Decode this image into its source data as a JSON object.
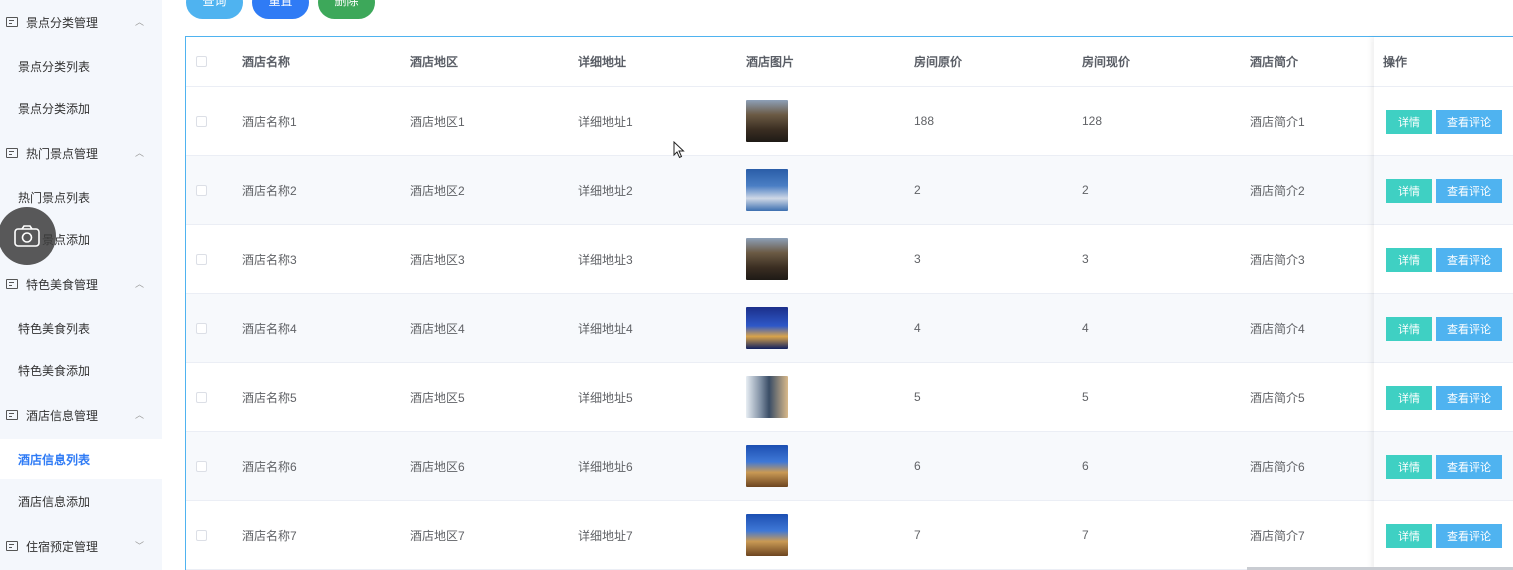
{
  "sidebar": {
    "groups": [
      {
        "label": "景点分类管理",
        "items": [
          "景点分类列表",
          "景点分类添加"
        ]
      },
      {
        "label": "热门景点管理",
        "items": [
          "热门景点列表",
          "景点添加"
        ]
      },
      {
        "label": "特色美食管理",
        "items": [
          "特色美食列表",
          "特色美食添加"
        ]
      },
      {
        "label": "酒店信息管理",
        "items": [
          "酒店信息列表",
          "酒店信息添加"
        ]
      },
      {
        "label": "住宿预定管理",
        "items": []
      }
    ],
    "active_item": "酒店信息列表"
  },
  "toolbar": {
    "query_label": "查询",
    "reset_label": "重置",
    "delete_label": "删除"
  },
  "table": {
    "columns": [
      "酒店名称",
      "酒店地区",
      "详细地址",
      "酒店图片",
      "房间原价",
      "房间现价",
      "酒店简介",
      "操作"
    ],
    "rows": [
      {
        "name": "酒店名称1",
        "region": "酒店地区1",
        "address": "详细地址1",
        "image": "hotel-photo-tower",
        "original_price": "188",
        "current_price": "128",
        "intro": "酒店简介1"
      },
      {
        "name": "酒店名称2",
        "region": "酒店地区2",
        "address": "详细地址2",
        "image": "hotel-photo-pool",
        "original_price": "2",
        "current_price": "2",
        "intro": "酒店简介2"
      },
      {
        "name": "酒店名称3",
        "region": "酒店地区3",
        "address": "详细地址3",
        "image": "hotel-photo-tower",
        "original_price": "3",
        "current_price": "3",
        "intro": "酒店简介3"
      },
      {
        "name": "酒店名称4",
        "region": "酒店地区4",
        "address": "详细地址4",
        "image": "hotel-photo-night-city",
        "original_price": "4",
        "current_price": "4",
        "intro": "酒店简介4"
      },
      {
        "name": "酒店名称5",
        "region": "酒店地区5",
        "address": "详细地址5",
        "image": "hotel-photo-glass-building",
        "original_price": "5",
        "current_price": "5",
        "intro": "酒店简介5"
      },
      {
        "name": "酒店名称6",
        "region": "酒店地区6",
        "address": "详细地址6",
        "image": "hotel-photo-palace",
        "original_price": "6",
        "current_price": "6",
        "intro": "酒店简介6"
      },
      {
        "name": "酒店名称7",
        "region": "酒店地区7",
        "address": "详细地址7",
        "image": "hotel-photo-palace",
        "original_price": "7",
        "current_price": "7",
        "intro": "酒店简介7"
      }
    ],
    "row_actions": {
      "detail_label": "详情",
      "review_label": "查看评论"
    }
  },
  "colors": {
    "primary": "#2f7bf5",
    "info": "#4fb3f0",
    "success": "#3da85a",
    "teal": "#3fd0c3",
    "sidebar_bg": "#f4f7fc"
  }
}
